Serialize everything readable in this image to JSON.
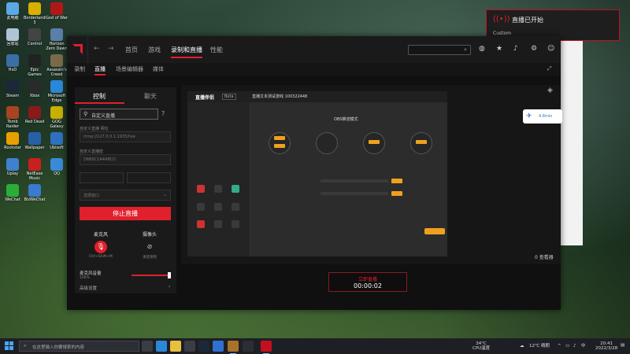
{
  "desktop": {
    "icons": [
      {
        "label": "此电脑",
        "color": "#5aa9e6"
      },
      {
        "label": "Borderlands 3",
        "color": "#d8b000"
      },
      {
        "label": "God of War",
        "color": "#b01818"
      },
      {
        "label": "回收站",
        "color": "#b0c4d8"
      },
      {
        "label": "Control",
        "color": "#444"
      },
      {
        "label": "Horizon Zero Dawn",
        "color": "#5a7fa8"
      },
      {
        "label": "HxD",
        "color": "#3a6ea5"
      },
      {
        "label": "Epic Games Launcher",
        "color": "#222"
      },
      {
        "label": "Assassin's Creed",
        "color": "#7a6a4a"
      },
      {
        "label": "Steam",
        "color": "#1b2838"
      },
      {
        "label": "Xbox",
        "color": "#2a2a2a"
      },
      {
        "label": "Microsoft Edge",
        "color": "#2b88d8"
      },
      {
        "label": "Tomb Raider",
        "color": "#a84420"
      },
      {
        "label": "Red Dead",
        "color": "#8a1a1a"
      },
      {
        "label": "GOG Galaxy",
        "color": "#c8b000"
      },
      {
        "label": "Rockstar",
        "color": "#e8a000"
      },
      {
        "label": "Wallpaper",
        "color": "#2860a8"
      },
      {
        "label": "Ubisoft",
        "color": "#3070c0"
      },
      {
        "label": "Uplay",
        "color": "#4080d0"
      },
      {
        "label": "NetEase Music",
        "color": "#c82020"
      },
      {
        "label": "QQ",
        "color": "#3a8ad8"
      },
      {
        "label": "WeChat",
        "color": "#2aae38"
      },
      {
        "label": "BizWeChat",
        "color": "#3a7ad0"
      }
    ]
  },
  "notification": {
    "title": "直播已开始",
    "subtitle": "Custom",
    "icon": "broadcast-icon"
  },
  "app": {
    "logo": "amd-logo",
    "nav": [
      "首页",
      "游戏",
      "录制和直播",
      "性能"
    ],
    "active_nav": "录制和直播",
    "subtabs": [
      "录制",
      "直播",
      "场景编辑器",
      "媒体"
    ],
    "active_subtab": "直播",
    "icons": [
      "globe-icon",
      "star-icon",
      "bell-icon",
      "gear-icon",
      "user-icon"
    ]
  },
  "left_panel": {
    "tabs": [
      "控制",
      "聊天"
    ],
    "active_tab": "控制",
    "service": "自定义直播",
    "url_label": "自定义直播 网址",
    "url_value": "rtmp://127.0.0.1:1935/live",
    "key_label": "自定义直播密",
    "key_value": "D6B6C1A4ABCD",
    "select_value": "选择窗口",
    "stop_button": "停止直播",
    "mic_title": "麦克风",
    "mic_hotkey": "Ctrl+Shift+M",
    "cam_title": "摄像头",
    "cam_status": "未检测到",
    "mic_volume_label": "麦克风音量",
    "mic_volume_value": "100%",
    "mic_volume_level": 1.0,
    "advanced_label": "高级设置"
  },
  "preview": {
    "inner_title": "直播伴侣",
    "inner_badge": "Beta",
    "inner_header_text": "直播文本测试游戏 100322448",
    "main_title": "OBS推流模式",
    "viewers": "0 查看器"
  },
  "cloud_badge": "4.8min",
  "timer": {
    "label": "立即直播",
    "value": "00:00:02"
  },
  "taskbar": {
    "search_placeholder": "在这里输入你要搜索的内容",
    "weather": "12℃ 晴朗",
    "cpu_temp": "34°C",
    "cpu_label": "CPU温度",
    "time": "20:41",
    "date": "2022/3/28"
  }
}
